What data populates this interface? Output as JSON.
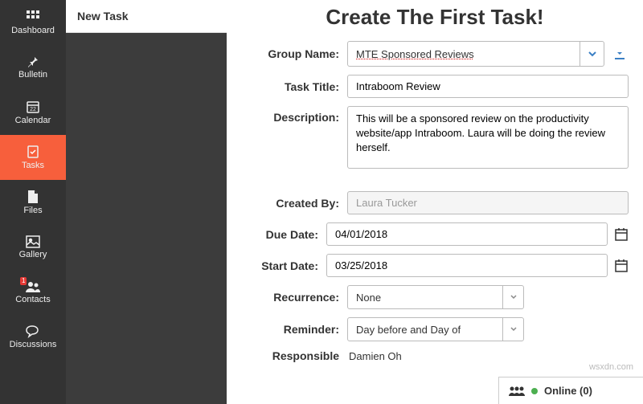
{
  "sidebar": {
    "items": [
      {
        "label": "Dashboard"
      },
      {
        "label": "Bulletin"
      },
      {
        "label": "Calendar"
      },
      {
        "label": "Tasks"
      },
      {
        "label": "Files"
      },
      {
        "label": "Gallery"
      },
      {
        "label": "Contacts",
        "badge": "1"
      },
      {
        "label": "Discussions"
      }
    ]
  },
  "panel": {
    "title": "New Task"
  },
  "main": {
    "title": "Create The First Task!",
    "labels": {
      "group": "Group Name:",
      "task": "Task Title:",
      "desc": "Description:",
      "created": "Created By:",
      "due": "Due Date:",
      "start": "Start Date:",
      "recur": "Recurrence:",
      "remind": "Reminder:",
      "resp": "Responsible"
    },
    "values": {
      "group": "MTE Sponsored Reviews",
      "task": "Intraboom Review",
      "desc": "This will be a sponsored review on the productivity website/app Intraboom. Laura will be doing the review herself.",
      "created": "Laura Tucker",
      "due": "04/01/2018",
      "start": "03/25/2018",
      "recur": "None",
      "remind": "Day before and Day of",
      "resp": "Damien Oh"
    }
  },
  "status": {
    "online_label": "Online (0)"
  },
  "watermark": "wsxdn.com"
}
